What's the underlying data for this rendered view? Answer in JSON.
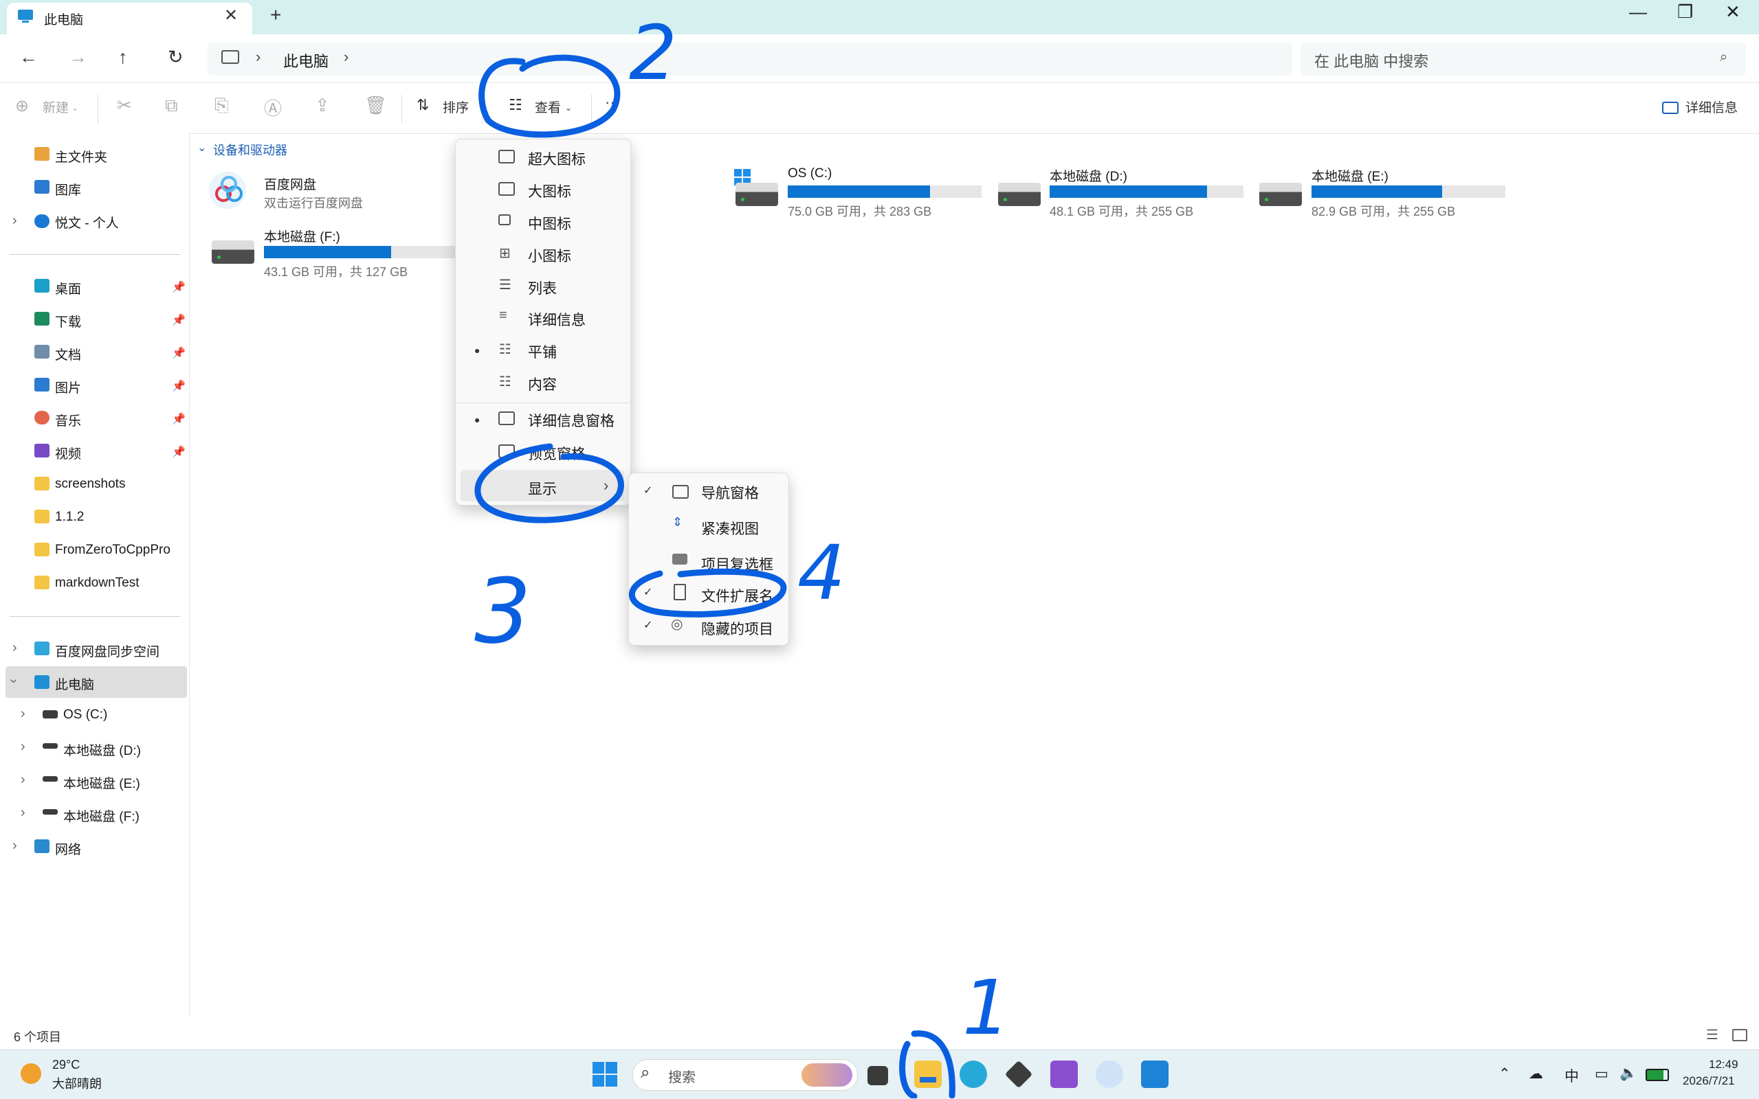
{
  "window": {
    "tab_title": "此电脑",
    "tab_close": "✕",
    "tab_add": "+",
    "minimize": "—",
    "maximize": "❐",
    "close": "✕"
  },
  "nav": {
    "back": "←",
    "forward": "→",
    "up": "↑",
    "refresh": "↻",
    "breadcrumb": [
      "此电脑"
    ],
    "separator": "›",
    "search_placeholder": "在 此电脑 中搜索",
    "search_icon": "⌕"
  },
  "toolbar": {
    "new": "新建",
    "sort": "排序",
    "view": "查看",
    "more": "···",
    "details": "详细信息"
  },
  "sidebar": {
    "home": "主文件夹",
    "gallery": "图库",
    "onedrive": "悦文 - 个人",
    "quick": [
      {
        "label": "桌面",
        "color": "#1aa0c8"
      },
      {
        "label": "下载",
        "color": "#1c8c5e"
      },
      {
        "label": "文档",
        "color": "#6f8ca8"
      },
      {
        "label": "图片",
        "color": "#2b7bd0"
      },
      {
        "label": "音乐",
        "color": "#e2664c"
      },
      {
        "label": "视频",
        "color": "#7a49c8"
      }
    ],
    "folders": [
      "screenshots",
      "1.1.2",
      "FromZeroToCppPro",
      "markdownTest"
    ],
    "baidu_sync": "百度网盘同步空间",
    "this_pc": "此电脑",
    "drives": [
      "OS (C:)",
      "本地磁盘 (D:)",
      "本地磁盘 (E:)",
      "本地磁盘 (F:)"
    ],
    "network": "网络"
  },
  "content": {
    "group_title": "设备和驱动器",
    "baidu": {
      "name": "百度网盘",
      "sub": "双击运行百度网盘"
    },
    "drives": [
      {
        "name": "本地磁盘 (F:)",
        "sub": "43.1 GB 可用，共 127 GB",
        "used_fraction": 0.66
      },
      {
        "name": "OS (C:)",
        "sub": "75.0 GB 可用，共 283 GB",
        "used_fraction": 0.735
      },
      {
        "name": "本地磁盘 (D:)",
        "sub": "48.1 GB 可用，共 255 GB",
        "used_fraction": 0.811
      },
      {
        "name": "本地磁盘 (E:)",
        "sub": "82.9 GB 可用，共 255 GB",
        "used_fraction": 0.675
      }
    ]
  },
  "view_menu": {
    "items": [
      "超大图标",
      "大图标",
      "中图标",
      "小图标",
      "列表",
      "详细信息",
      "平铺",
      "内容"
    ],
    "selected": "平铺",
    "pane_items": [
      "详细信息窗格",
      "预览窗格"
    ],
    "pane_selected": "详细信息窗格",
    "show": "显示",
    "show_arrow": "›"
  },
  "show_menu": {
    "items": [
      {
        "label": "导航窗格",
        "checked": true
      },
      {
        "label": "紧凑视图",
        "checked": false
      },
      {
        "label": "项目复选框",
        "checked": false
      },
      {
        "label": "文件扩展名",
        "checked": true
      },
      {
        "label": "隐藏的项目",
        "checked": true
      }
    ],
    "check_glyph": "✓"
  },
  "status": {
    "count": "6 个项目"
  },
  "taskbar": {
    "weather_temp": "29°C",
    "weather_desc": "大部晴朗",
    "search": "搜索",
    "ime": "中",
    "time": "12:49",
    "date": "2026/7/21"
  },
  "annotations": [
    "1",
    "2",
    "3",
    "4"
  ]
}
